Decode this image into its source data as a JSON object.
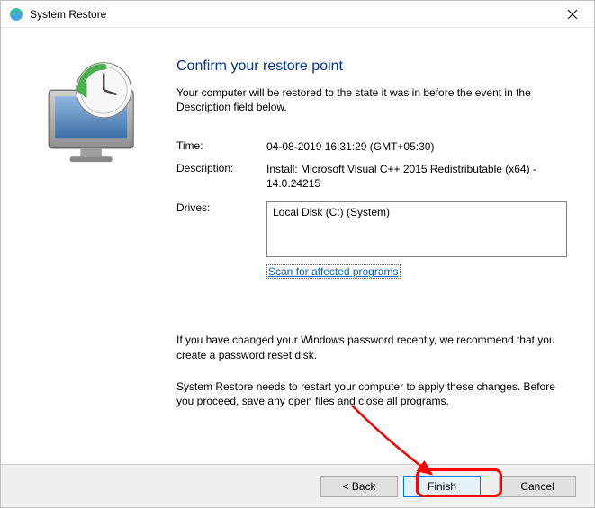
{
  "titlebar": {
    "title": "System Restore"
  },
  "heading": "Confirm your restore point",
  "intro": "Your computer will be restored to the state it was in before the event in the Description field below.",
  "fields": {
    "time_label": "Time:",
    "time_value": "04-08-2019 16:31:29 (GMT+05:30)",
    "desc_label": "Description:",
    "desc_value": "Install: Microsoft Visual C++ 2015 Redistributable (x64) - 14.0.24215",
    "drives_label": "Drives:",
    "drives_value": "Local Disk (C:) (System)"
  },
  "scan_link": "Scan for affected programs",
  "warn1": "If you have changed your Windows password recently, we recommend that you create a password reset disk.",
  "warn2": "System Restore needs to restart your computer to apply these changes. Before you proceed, save any open files and close all programs.",
  "buttons": {
    "back": "< Back",
    "finish": "Finish",
    "cancel": "Cancel"
  }
}
